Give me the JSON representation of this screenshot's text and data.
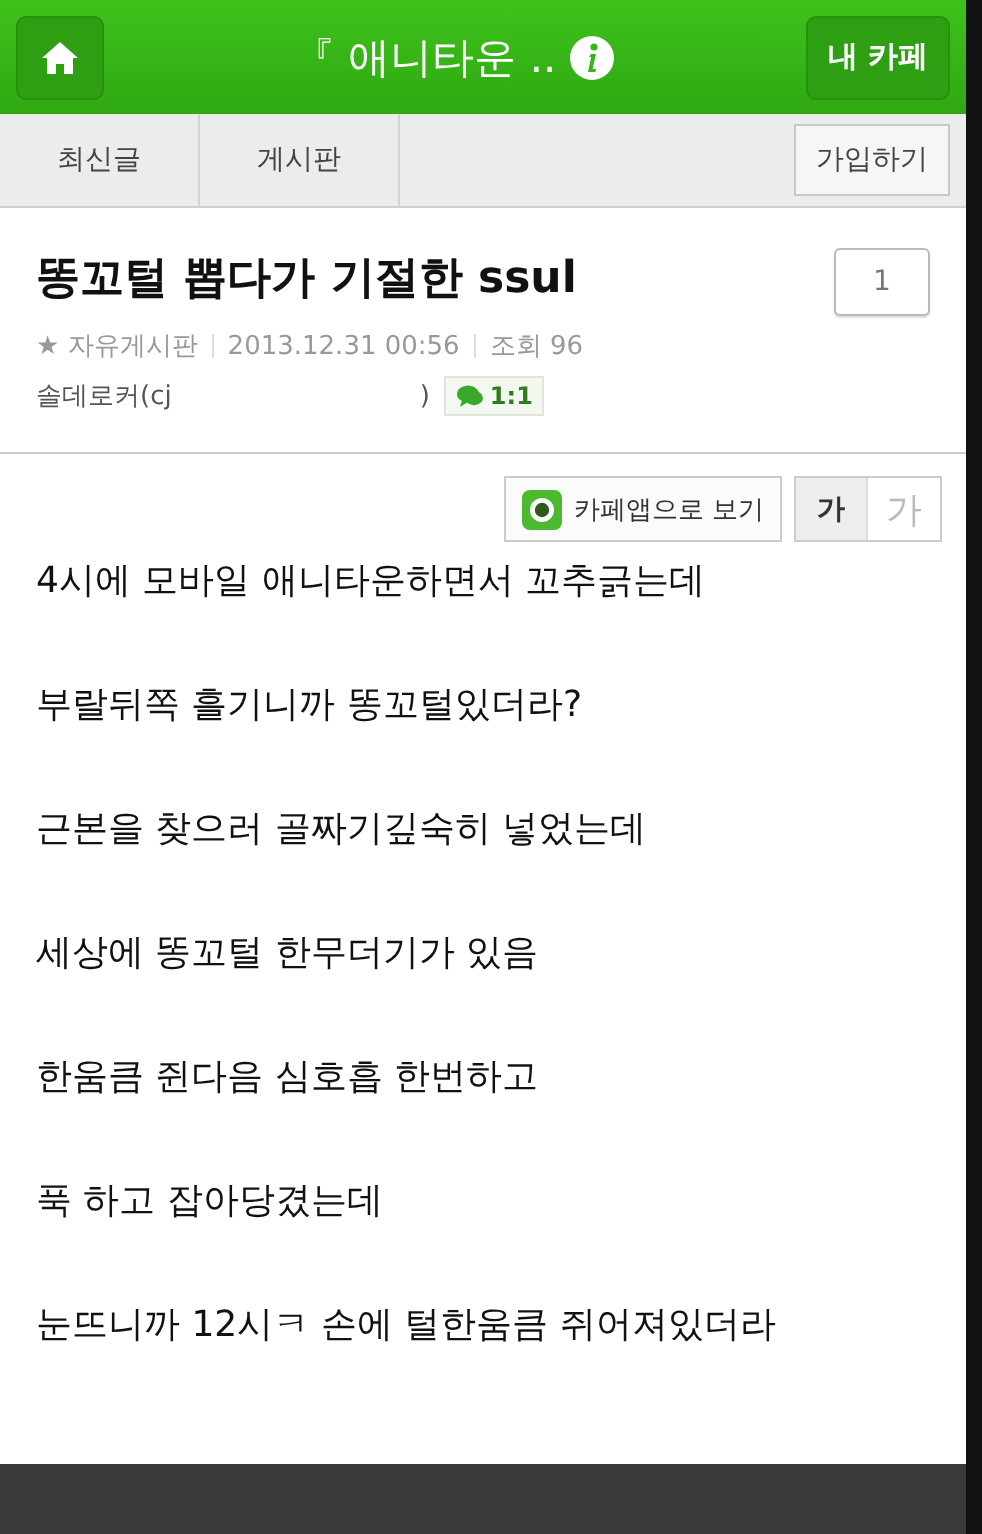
{
  "header": {
    "title": "『 애니타운 ..",
    "my_cafe": "내 카페"
  },
  "tabs": [
    {
      "label": "최신글",
      "selected": false
    },
    {
      "label": "게시판",
      "selected": false
    }
  ],
  "join_button": "가입하기",
  "post": {
    "title": "똥꼬털 뽑다가 기절한 ssul",
    "comment_count": "1",
    "board": "★ 자유게시판",
    "date": "2013.12.31 00:56",
    "views": "조회 96",
    "author": "솔데로커(cj",
    "author_end": ")",
    "chat": "1:1"
  },
  "toolbar": {
    "app_button": "카페앱으로 보기",
    "font_sizes": [
      {
        "label": "가",
        "selected": true
      },
      {
        "label": "가",
        "selected": false
      }
    ]
  },
  "paragraphs": [
    "4시에 모바일 애니타운하면서 꼬추긁는데",
    "부랄뒤쪽 흘기니까 똥꼬털있더라?",
    "근본을 찾으러 골짜기깊숙히 넣었는데",
    "세상에 똥꼬털 한무더기가 있음",
    "한움큼 쥔다음 심호흡 한번하고",
    "푹 하고 잡아당겼는데",
    "눈뜨니까 12시ㅋ 손에 털한움큼 쥐어져있더라"
  ]
}
